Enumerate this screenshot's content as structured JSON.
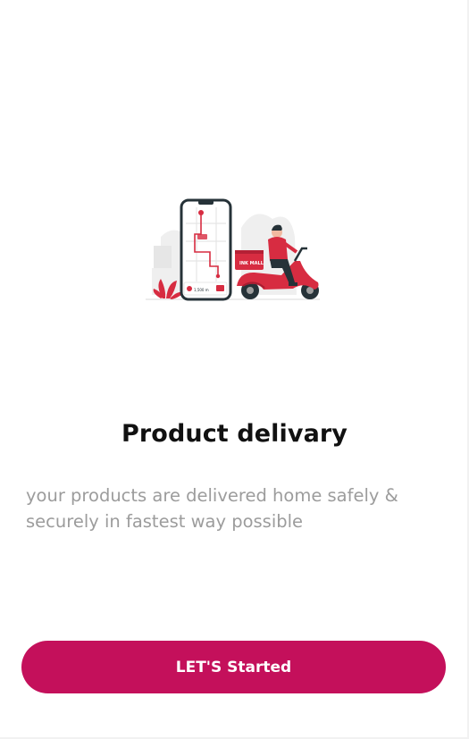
{
  "onboarding": {
    "title": "Product delivary",
    "description": "your products are delivered home safely & securely in fastest way possible",
    "cta_label": "LET'S Started",
    "illustration": {
      "icon": "delivery-scooter-illustration",
      "box_label": "INK MALL",
      "phone_card_value": "1,500 m"
    }
  },
  "colors": {
    "accent": "#c4105b",
    "scooter": "#d72c41",
    "title": "#111111",
    "description": "#9c9c9c",
    "background": "#ffffff"
  }
}
